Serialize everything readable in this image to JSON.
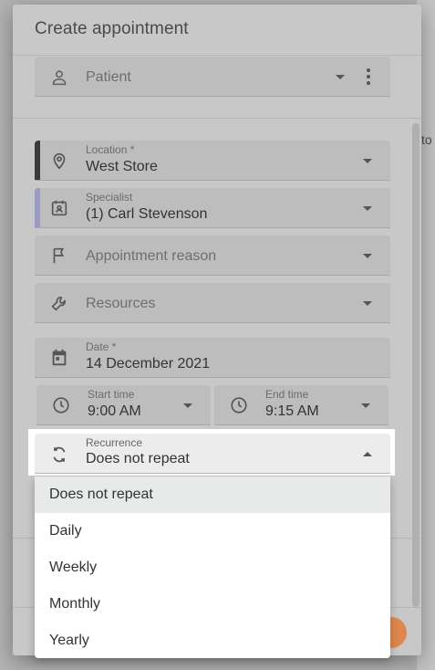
{
  "dialog": {
    "title": "Create appointment"
  },
  "background": {
    "fragment_text": "to"
  },
  "fields": {
    "patient": {
      "placeholder": "Patient",
      "icon": "person-icon"
    },
    "location": {
      "label": "Location *",
      "value": "West Store",
      "icon": "location-pin-icon",
      "accent": "#3a3a3a"
    },
    "specialist": {
      "label": "Specialist",
      "value": "(1) Carl Stevenson",
      "icon": "calendar-person-icon",
      "accent": "#9a9ac2"
    },
    "reason": {
      "placeholder": "Appointment reason",
      "icon": "flag-icon"
    },
    "resources": {
      "placeholder": "Resources",
      "icon": "wrench-icon"
    },
    "date": {
      "label": "Date *",
      "value": "14 December 2021",
      "icon": "calendar-icon"
    },
    "start_time": {
      "label": "Start time",
      "value": "9:00 AM",
      "icon": "clock-icon"
    },
    "end_time": {
      "label": "End time",
      "value": "9:15 AM",
      "icon": "clock-icon"
    },
    "recurrence": {
      "label": "Recurrence",
      "value": "Does not repeat",
      "icon": "repeat-icon"
    }
  },
  "recurrence_options": [
    "Does not repeat",
    "Daily",
    "Weekly",
    "Monthly",
    "Yearly"
  ],
  "colors": {
    "accent_orange": "#e0874f",
    "location_accent": "#3a3a3a",
    "specialist_accent": "#9a9ac2"
  }
}
